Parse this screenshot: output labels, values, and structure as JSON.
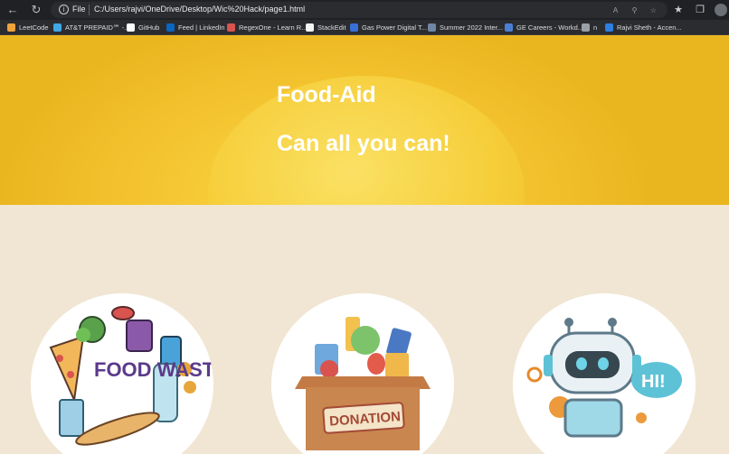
{
  "browser": {
    "file_label": "File",
    "url": "C:/Users/rajvi/OneDrive/Desktop/Wic%20Hack/page1.html",
    "bookmarks": [
      {
        "label": "LeetCode",
        "color": "#f0a23b"
      },
      {
        "label": "AT&T PREPAID℠ -...",
        "color": "#3ea7e6"
      },
      {
        "label": "GitHub",
        "color": "#ffffff"
      },
      {
        "label": "Feed | LinkedIn",
        "color": "#0a66c2"
      },
      {
        "label": "RegexOne - Learn R...",
        "color": "#d9534f"
      },
      {
        "label": "StackEdit",
        "color": "#f5f5f5"
      },
      {
        "label": "Gas Power Digital T...",
        "color": "#3b6fd8"
      },
      {
        "label": "Summer 2022 Inter...",
        "color": "#6f86a6"
      },
      {
        "label": "GE Careers - Workd...",
        "color": "#4a7fd4"
      },
      {
        "label": "n",
        "color": "#9aa0a6"
      },
      {
        "label": "Rajvi Sheth - Accen...",
        "color": "#2d7fe0"
      }
    ]
  },
  "hero": {
    "title": "Food-Aid",
    "tagline": "Can all you can!"
  },
  "cards": [
    {
      "image_text": "FOOD WASTE"
    },
    {
      "image_text": "DONATION"
    },
    {
      "image_text": "HI!"
    }
  ],
  "colors": {
    "hero_yellow": "#f4c430",
    "page_bg": "#f1e6d3",
    "chrome_dark": "#202124"
  }
}
